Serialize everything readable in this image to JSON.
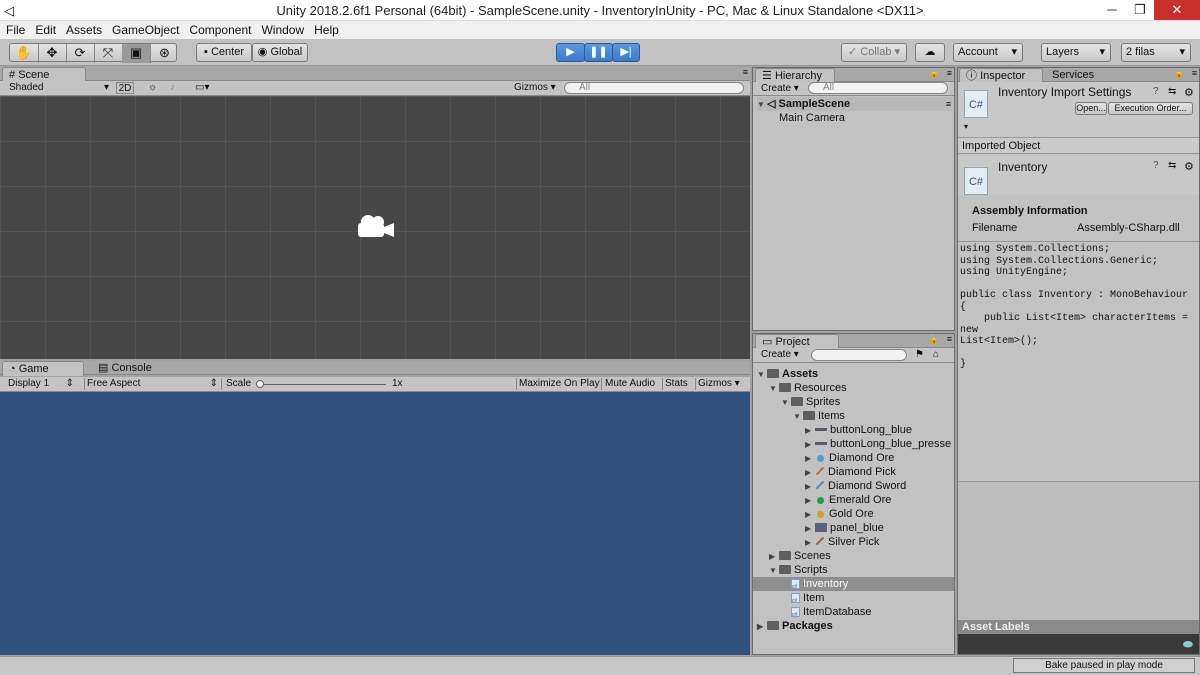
{
  "window": {
    "title": "Unity 2018.2.6f1 Personal (64bit) - SampleScene.unity - InventoryInUnity - PC, Mac & Linux Standalone <DX11>",
    "minimize": "─",
    "maximize": "❐",
    "close": "✕"
  },
  "menu": [
    "File",
    "Edit",
    "Assets",
    "GameObject",
    "Component",
    "Window",
    "Help"
  ],
  "toolbar": {
    "tools": [
      "hand-tool",
      "move-tool",
      "rotate-tool",
      "scale-tool",
      "rect-tool",
      "transform-tool"
    ],
    "pivot": "Center",
    "space": "Global",
    "collab": "Collab ▾",
    "account": "Account",
    "layers": "Layers",
    "layout": "2 filas"
  },
  "scene": {
    "tab": "Scene",
    "shading": "Shaded",
    "mode2d": "2D",
    "gizmos": "Gizmos",
    "search_placeholder": "All"
  },
  "game": {
    "tab": "Game",
    "console_tab": "Console",
    "display": "Display 1",
    "aspect": "Free Aspect",
    "scale_label": "Scale",
    "scale_value": "1x",
    "maximize": "Maximize On Play",
    "mute": "Mute Audio",
    "stats": "Stats",
    "gizmos": "Gizmos"
  },
  "hierarchy": {
    "tab": "Hierarchy",
    "create": "Create",
    "search_placeholder": "All",
    "scene": "SampleScene",
    "items": [
      "Main Camera"
    ]
  },
  "project": {
    "tab": "Project",
    "create": "Create",
    "tree": [
      {
        "label": "Assets",
        "depth": 0,
        "kind": "folder",
        "expanded": true,
        "bold": true
      },
      {
        "label": "Resources",
        "depth": 1,
        "kind": "folder",
        "expanded": true
      },
      {
        "label": "Sprites",
        "depth": 2,
        "kind": "folder",
        "expanded": true
      },
      {
        "label": "Items",
        "depth": 3,
        "kind": "folder",
        "expanded": true
      },
      {
        "label": "buttonLong_blue",
        "depth": 4,
        "kind": "sprite",
        "color": "#5a5a6a"
      },
      {
        "label": "buttonLong_blue_presse",
        "depth": 4,
        "kind": "sprite",
        "color": "#5a5a6a"
      },
      {
        "label": "Diamond Ore",
        "depth": 4,
        "kind": "sprite",
        "color": "#4aa0d8"
      },
      {
        "label": "Diamond Pick",
        "depth": 4,
        "kind": "sprite",
        "color": "#b07040"
      },
      {
        "label": "Diamond Sword",
        "depth": 4,
        "kind": "sprite",
        "color": "#4a8ab0"
      },
      {
        "label": "Emerald Ore",
        "depth": 4,
        "kind": "sprite",
        "color": "#2a9a4a"
      },
      {
        "label": "Gold Ore",
        "depth": 4,
        "kind": "sprite",
        "color": "#d8a020"
      },
      {
        "label": "panel_blue",
        "depth": 4,
        "kind": "sprite",
        "color": "#5a6080"
      },
      {
        "label": "Silver Pick",
        "depth": 4,
        "kind": "sprite",
        "color": "#a06030"
      },
      {
        "label": "Scenes",
        "depth": 1,
        "kind": "folder",
        "expanded": false
      },
      {
        "label": "Scripts",
        "depth": 1,
        "kind": "folder",
        "expanded": true
      },
      {
        "label": "Inventory",
        "depth": 2,
        "kind": "script",
        "selected": true
      },
      {
        "label": "Item",
        "depth": 2,
        "kind": "script"
      },
      {
        "label": "ItemDatabase",
        "depth": 2,
        "kind": "script"
      },
      {
        "label": "Packages",
        "depth": 0,
        "kind": "folder",
        "expanded": false,
        "bold": true
      }
    ]
  },
  "inspector": {
    "tab": "Inspector",
    "services_tab": "Services",
    "header_title": "Inventory Import Settings",
    "open_btn": "Open...",
    "exec_btn": "Execution Order...",
    "imported_label": "Imported Object",
    "object_name": "Inventory",
    "assembly_heading": "Assembly Information",
    "filename_label": "Filename",
    "filename_value": "Assembly-CSharp.dll",
    "code": "using System.Collections;\nusing System.Collections.Generic;\nusing UnityEngine;\n\npublic class Inventory : MonoBehaviour {\n    public List<Item> characterItems = new\nList<Item>();\n\n}",
    "asset_labels": "Asset Labels",
    "cs_icon": "C#"
  },
  "status": {
    "bake": "Bake paused in play mode"
  },
  "colors": {
    "game_view": "#30507e",
    "scene_bg": "#474747",
    "play_active": "#3a7ac8"
  }
}
